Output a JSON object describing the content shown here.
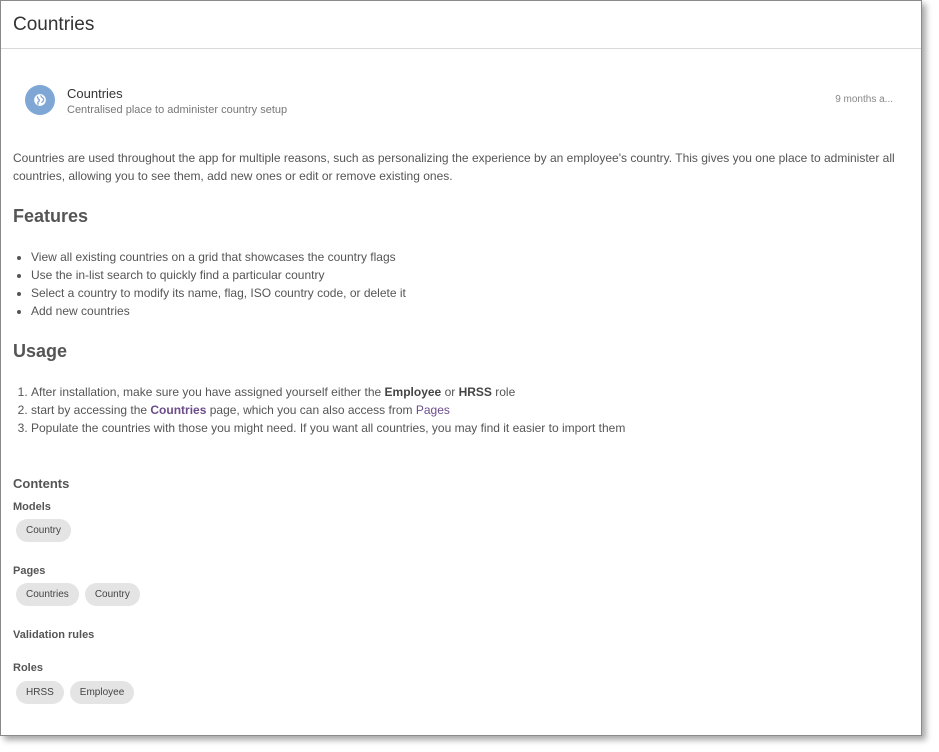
{
  "window": {
    "title": "Countries"
  },
  "app": {
    "icon": "globe-icon",
    "name": "Countries",
    "description": "Centralised place to administer country setup",
    "updated": "9 months a..."
  },
  "intro": "Countries are used throughout the app for multiple reasons, such as personalizing the experience by an employee's country. This gives you one place to administer all countries, allowing you to see them, add new ones or edit or remove existing ones.",
  "features": {
    "heading": "Features",
    "items": [
      "View all existing countries on a grid that showcases the country flags",
      "Use the in-list search to quickly find a particular country",
      "Select a country to modify its name, flag, ISO country code, or delete it",
      "Add new countries"
    ]
  },
  "usage": {
    "heading": "Usage",
    "step1": {
      "before": "After installation, make sure you have assigned yourself either the ",
      "role1": "Employee",
      "mid": " or ",
      "role2": "HRSS",
      "after": " role"
    },
    "step2": {
      "before": "start by accessing the ",
      "link1": "Countries",
      "mid": " page, which you can also access from ",
      "link2": "Pages"
    },
    "step3": "Populate the countries with those you might need. If you want all countries, you may find it easier to import them"
  },
  "contents": {
    "title": "Contents",
    "models": {
      "label": "Models",
      "chips": [
        "Country"
      ]
    },
    "pages": {
      "label": "Pages",
      "chips": [
        "Countries",
        "Country"
      ]
    },
    "validation": {
      "label": "Validation rules"
    },
    "roles": {
      "label": "Roles",
      "chips": [
        "HRSS",
        "Employee"
      ]
    }
  },
  "colors": {
    "icon_bg": "#7fa7d6",
    "link": "#6b4c8a",
    "chip_bg": "#e4e4e4"
  }
}
